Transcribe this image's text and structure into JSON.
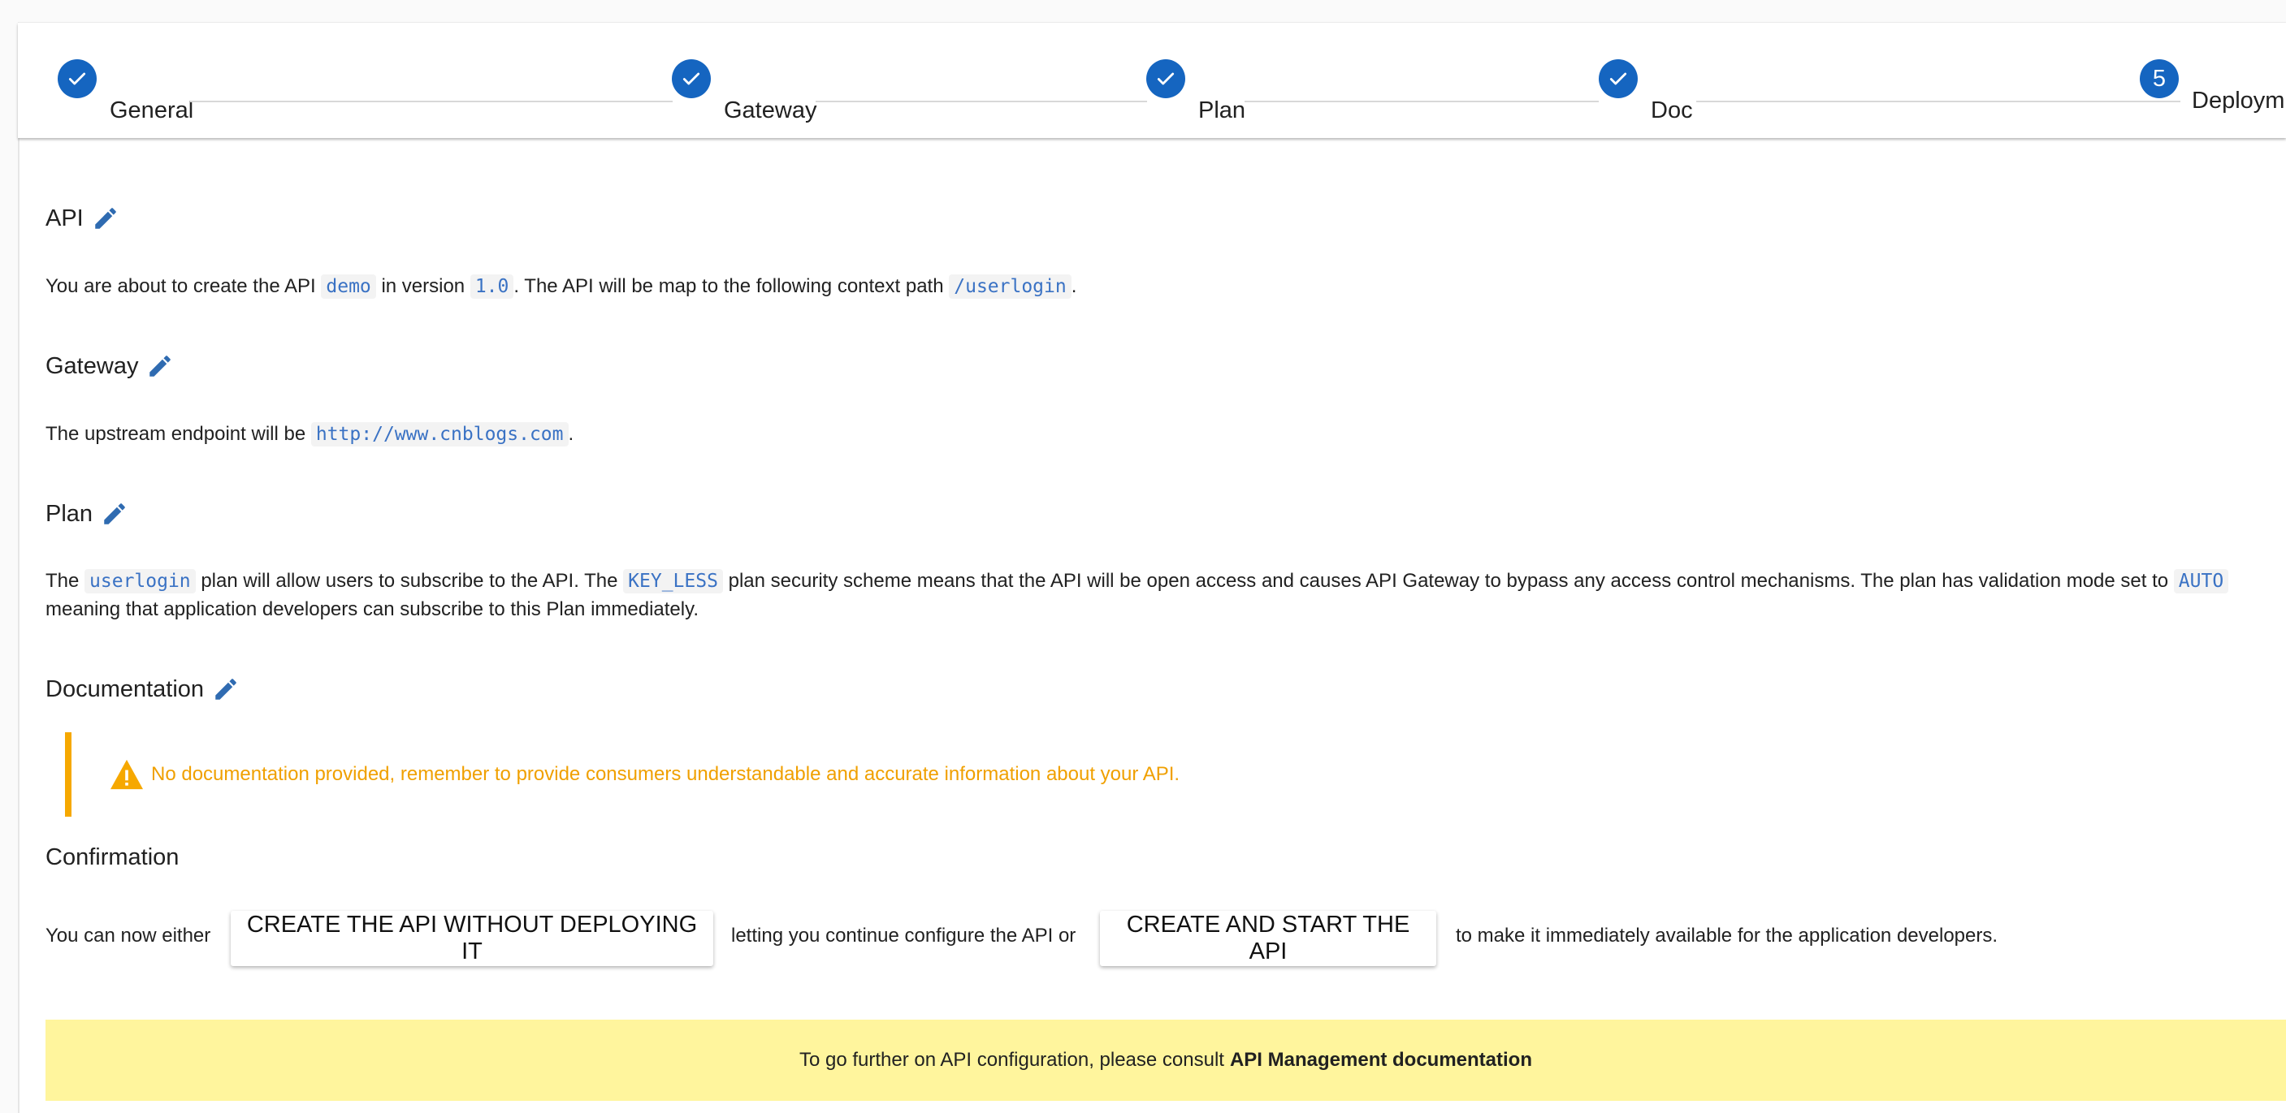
{
  "stepper": {
    "steps": [
      {
        "label": "General",
        "state": "complete"
      },
      {
        "label": "Gateway",
        "state": "complete"
      },
      {
        "label": "Plan",
        "state": "complete"
      },
      {
        "label": "Doc",
        "state": "complete"
      },
      {
        "label": "Deploym",
        "number": "5",
        "state": "active"
      }
    ]
  },
  "sections": {
    "api": {
      "title": "API",
      "text_1": "You are about to create the API",
      "name": "demo",
      "text_2": "in version",
      "version": "1.0",
      "text_3": ". The API will be map to the following context path",
      "context_path": "/userlogin",
      "text_4": "."
    },
    "gateway": {
      "title": "Gateway",
      "text_1": "The upstream endpoint will be",
      "endpoint": "http://www.cnblogs.com",
      "text_2": "."
    },
    "plan": {
      "title": "Plan",
      "text_1": "The",
      "plan_name": "userlogin",
      "text_2": "plan will allow users to subscribe to the API. The",
      "security": "KEY_LESS",
      "text_3": "plan security scheme means that the API will be open access and causes API Gateway to bypass any access control mechanisms. The plan has validation mode set to",
      "validation": "AUTO",
      "text_4": "meaning that application developers can subscribe to this Plan immediately."
    },
    "documentation": {
      "title": "Documentation",
      "warning": "No documentation provided, remember to provide consumers understandable and accurate information about your API."
    },
    "confirmation": {
      "title": "Confirmation",
      "text_1": "You can now either",
      "button_create": "CREATE THE API WITHOUT DEPLOYING IT",
      "text_2": "letting you continue configure the API or",
      "button_create_start": "CREATE AND START THE API",
      "text_3": "to make it immediately available for the application developers."
    }
  },
  "footer": {
    "text": "To go further on API configuration, please consult",
    "link": "API Management documentation"
  },
  "colors": {
    "primary": "#1565c0",
    "edit_icon": "#2f6bb1",
    "code": "#3a72c4",
    "warning": "#f6a800",
    "footer_bg": "#fff59d"
  },
  "icons": {
    "step_complete": "check-icon",
    "edit": "pencil-icon",
    "warning": "warning-icon"
  }
}
